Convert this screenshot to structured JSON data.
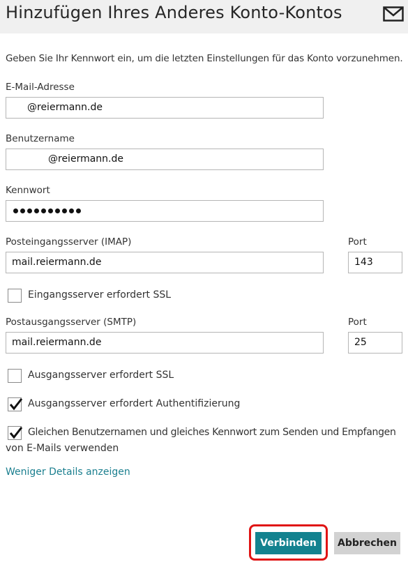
{
  "header": {
    "title": "Hinzufügen Ihres Anderes Konto-Kontos",
    "icon": "mail-icon"
  },
  "intro_text": "Geben Sie Ihr Kennwort ein, um die letzten Einstellungen für das Konto vorzunehmen.",
  "fields": {
    "email": {
      "label": "E-Mail-Adresse",
      "value": "@reiermann.de"
    },
    "username": {
      "label": "Benutzername",
      "value": "@reiermann.de"
    },
    "password": {
      "label": "Kennwort",
      "masked_length": 10
    },
    "incoming_server": {
      "label": "Posteingangsserver (IMAP)",
      "value": "mail.reiermann.de"
    },
    "incoming_port": {
      "label": "Port",
      "value": "143"
    },
    "outgoing_server": {
      "label": "Postausgangsserver (SMTP)",
      "value": "mail.reiermann.de"
    },
    "outgoing_port": {
      "label": "Port",
      "value": "25"
    }
  },
  "checkboxes": {
    "incoming_ssl": {
      "label": "Eingangsserver erfordert SSL",
      "checked": false
    },
    "outgoing_ssl": {
      "label": "Ausgangsserver erfordert SSL",
      "checked": false
    },
    "outgoing_auth": {
      "label": "Ausgangsserver erfordert Authentifizierung",
      "checked": true
    },
    "same_credentials": {
      "label_line1": "Gleichen Benutzernamen und gleiches Kennwort zum Senden und Empfangen",
      "label_line2": "von E-Mails verwenden",
      "checked": true
    }
  },
  "links": {
    "less_details": "Weniger Details anzeigen"
  },
  "buttons": {
    "connect": "Verbinden",
    "cancel": "Abbrechen"
  },
  "colors": {
    "accent": "#13828f",
    "link": "#1b7f8f",
    "highlight": "#e01414"
  }
}
